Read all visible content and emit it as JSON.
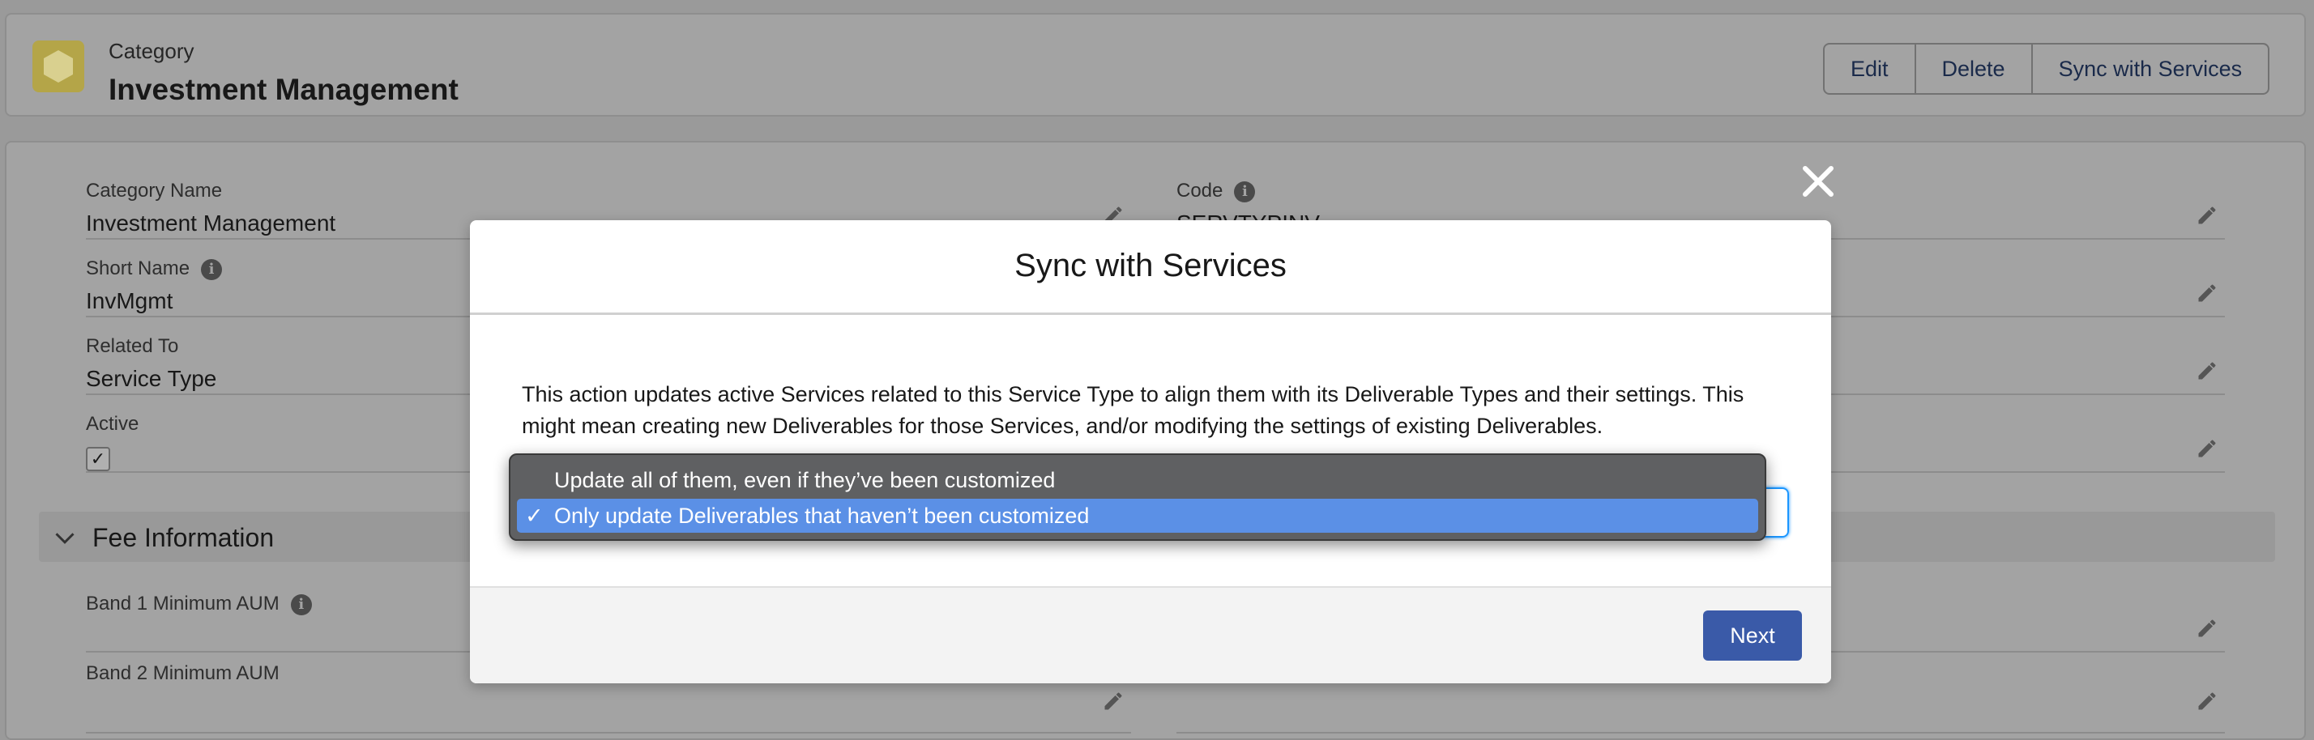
{
  "header": {
    "object_label": "Category",
    "record_title": "Investment Management",
    "actions": [
      "Edit",
      "Delete",
      "Sync with Services"
    ]
  },
  "fields": {
    "category_name": {
      "label": "Category Name",
      "value": "Investment Management"
    },
    "code": {
      "label": "Code",
      "value": "SERVTYPINV"
    },
    "short_name": {
      "label": "Short Name",
      "value": "InvMgmt"
    },
    "related_to": {
      "label": "Related To",
      "value": "Service Type"
    },
    "active": {
      "label": "Active",
      "checked": true
    },
    "band1_min": {
      "label": "Band 1 Minimum AUM",
      "value": ""
    },
    "band2_min": {
      "label": "Band 2 Minimum AUM",
      "value": ""
    }
  },
  "section": {
    "title": "Fee Information"
  },
  "modal": {
    "title": "Sync with Services",
    "description": "This action updates active Services related to this Service Type to align them with its Deliverable Types and their settings. This might mean creating new Deliverables for those Services, and/or modifying the settings of existing Deliverables.",
    "next_label": "Next"
  },
  "dropdown": {
    "options": [
      {
        "label": "Update all of them, even if they’ve been customized",
        "selected": false
      },
      {
        "label": "Only update Deliverables that haven’t been customized",
        "selected": true
      }
    ],
    "check_glyph": "✓"
  },
  "icons": {
    "pencil": "pencil-icon",
    "info": "info-icon",
    "close": "close-icon",
    "chevron": "chevron-down-icon"
  },
  "colors": {
    "accent": "#3a5aa8",
    "selected_option": "#5b90e6",
    "category_icon": "#b4a548"
  }
}
